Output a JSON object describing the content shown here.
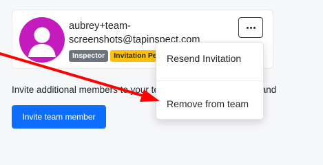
{
  "member": {
    "email_line1": "aubrey+team-",
    "email_line2": "screenshots@tapinspect.com",
    "role_badge": "Inspector",
    "status_badge": "Invitation Pending",
    "avatar_color": "#c41bbf"
  },
  "menu": {
    "items": [
      {
        "label": "Resend Invitation"
      },
      {
        "label": "Remove from team"
      }
    ]
  },
  "info_text": "Invite additional members to your team. You can also create and",
  "invite_button_label": "Invite team member",
  "colors": {
    "primary": "#0d6efd",
    "badge_role": "#6c757d",
    "badge_status": "#ffc107",
    "arrow": "#ff0000"
  },
  "icons": {
    "more_button": "ellipsis-icon",
    "avatar": "user-placeholder-icon",
    "arrow": "red-annotation-arrow"
  }
}
